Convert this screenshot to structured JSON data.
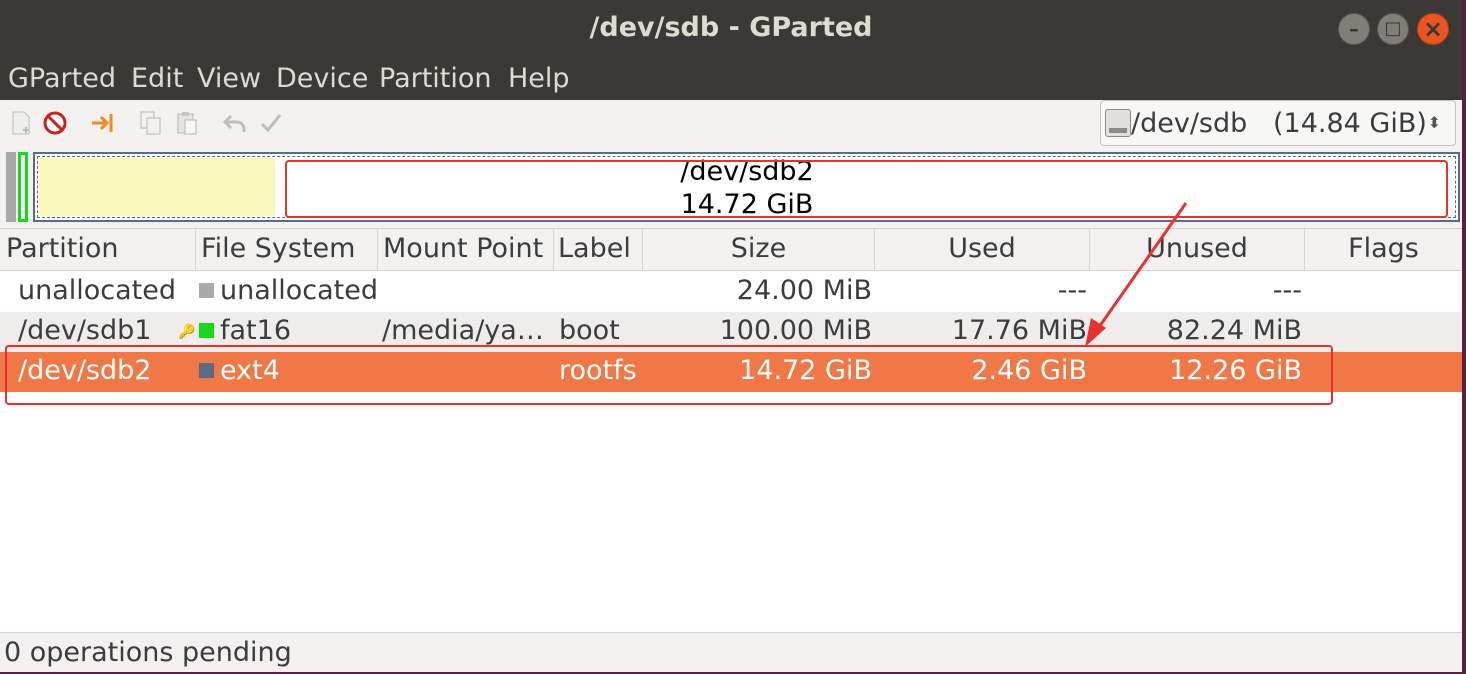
{
  "window": {
    "title": "/dev/sdb - GParted",
    "controls": {
      "minimize": "–",
      "maximize": "□",
      "close": "×"
    }
  },
  "menubar": {
    "items": [
      "GParted",
      "Edit",
      "View",
      "Device",
      "Partition",
      "Help"
    ]
  },
  "toolbar": {
    "icons": [
      "new-partition-icon",
      "delete-icon",
      "resize-move-icon",
      "copy-icon",
      "paste-icon",
      "undo-icon",
      "apply-icon"
    ],
    "device": {
      "name": "/dev/sdb",
      "size": "(14.84 GiB)"
    }
  },
  "graph": {
    "selected_name": "/dev/sdb2",
    "selected_size": "14.72 GiB",
    "colors": {
      "unallocated": "#a9a9a9",
      "fat16": "#18d918",
      "ext4": "#576c85",
      "used": "#f8f7bc"
    }
  },
  "table": {
    "columns": [
      "Partition",
      "File System",
      "Mount Point",
      "Label",
      "Size",
      "Used",
      "Unused",
      "Flags"
    ],
    "rows": [
      {
        "partition": "unallocated",
        "fs": "unallocated",
        "fs_color": "#a9a9a9",
        "mount": "",
        "label": "",
        "size": "24.00 MiB",
        "used": "---",
        "unused": "---",
        "flags": ""
      },
      {
        "partition": "/dev/sdb1",
        "fs": "fat16",
        "fs_color": "#18d918",
        "mount": "/media/ya…",
        "label": "boot",
        "size": "100.00 MiB",
        "used": "17.76 MiB",
        "unused": "82.24 MiB",
        "flags": ""
      },
      {
        "partition": "/dev/sdb2",
        "fs": "ext4",
        "fs_color": "#576c85",
        "mount": "",
        "label": "rootfs",
        "size": "14.72 GiB",
        "used": "2.46 GiB",
        "unused": "12.26 GiB",
        "flags": ""
      }
    ],
    "selected_row_color": "#f07746"
  },
  "statusbar": {
    "text": "0 operations pending"
  },
  "annotation_color": "#e8312f"
}
